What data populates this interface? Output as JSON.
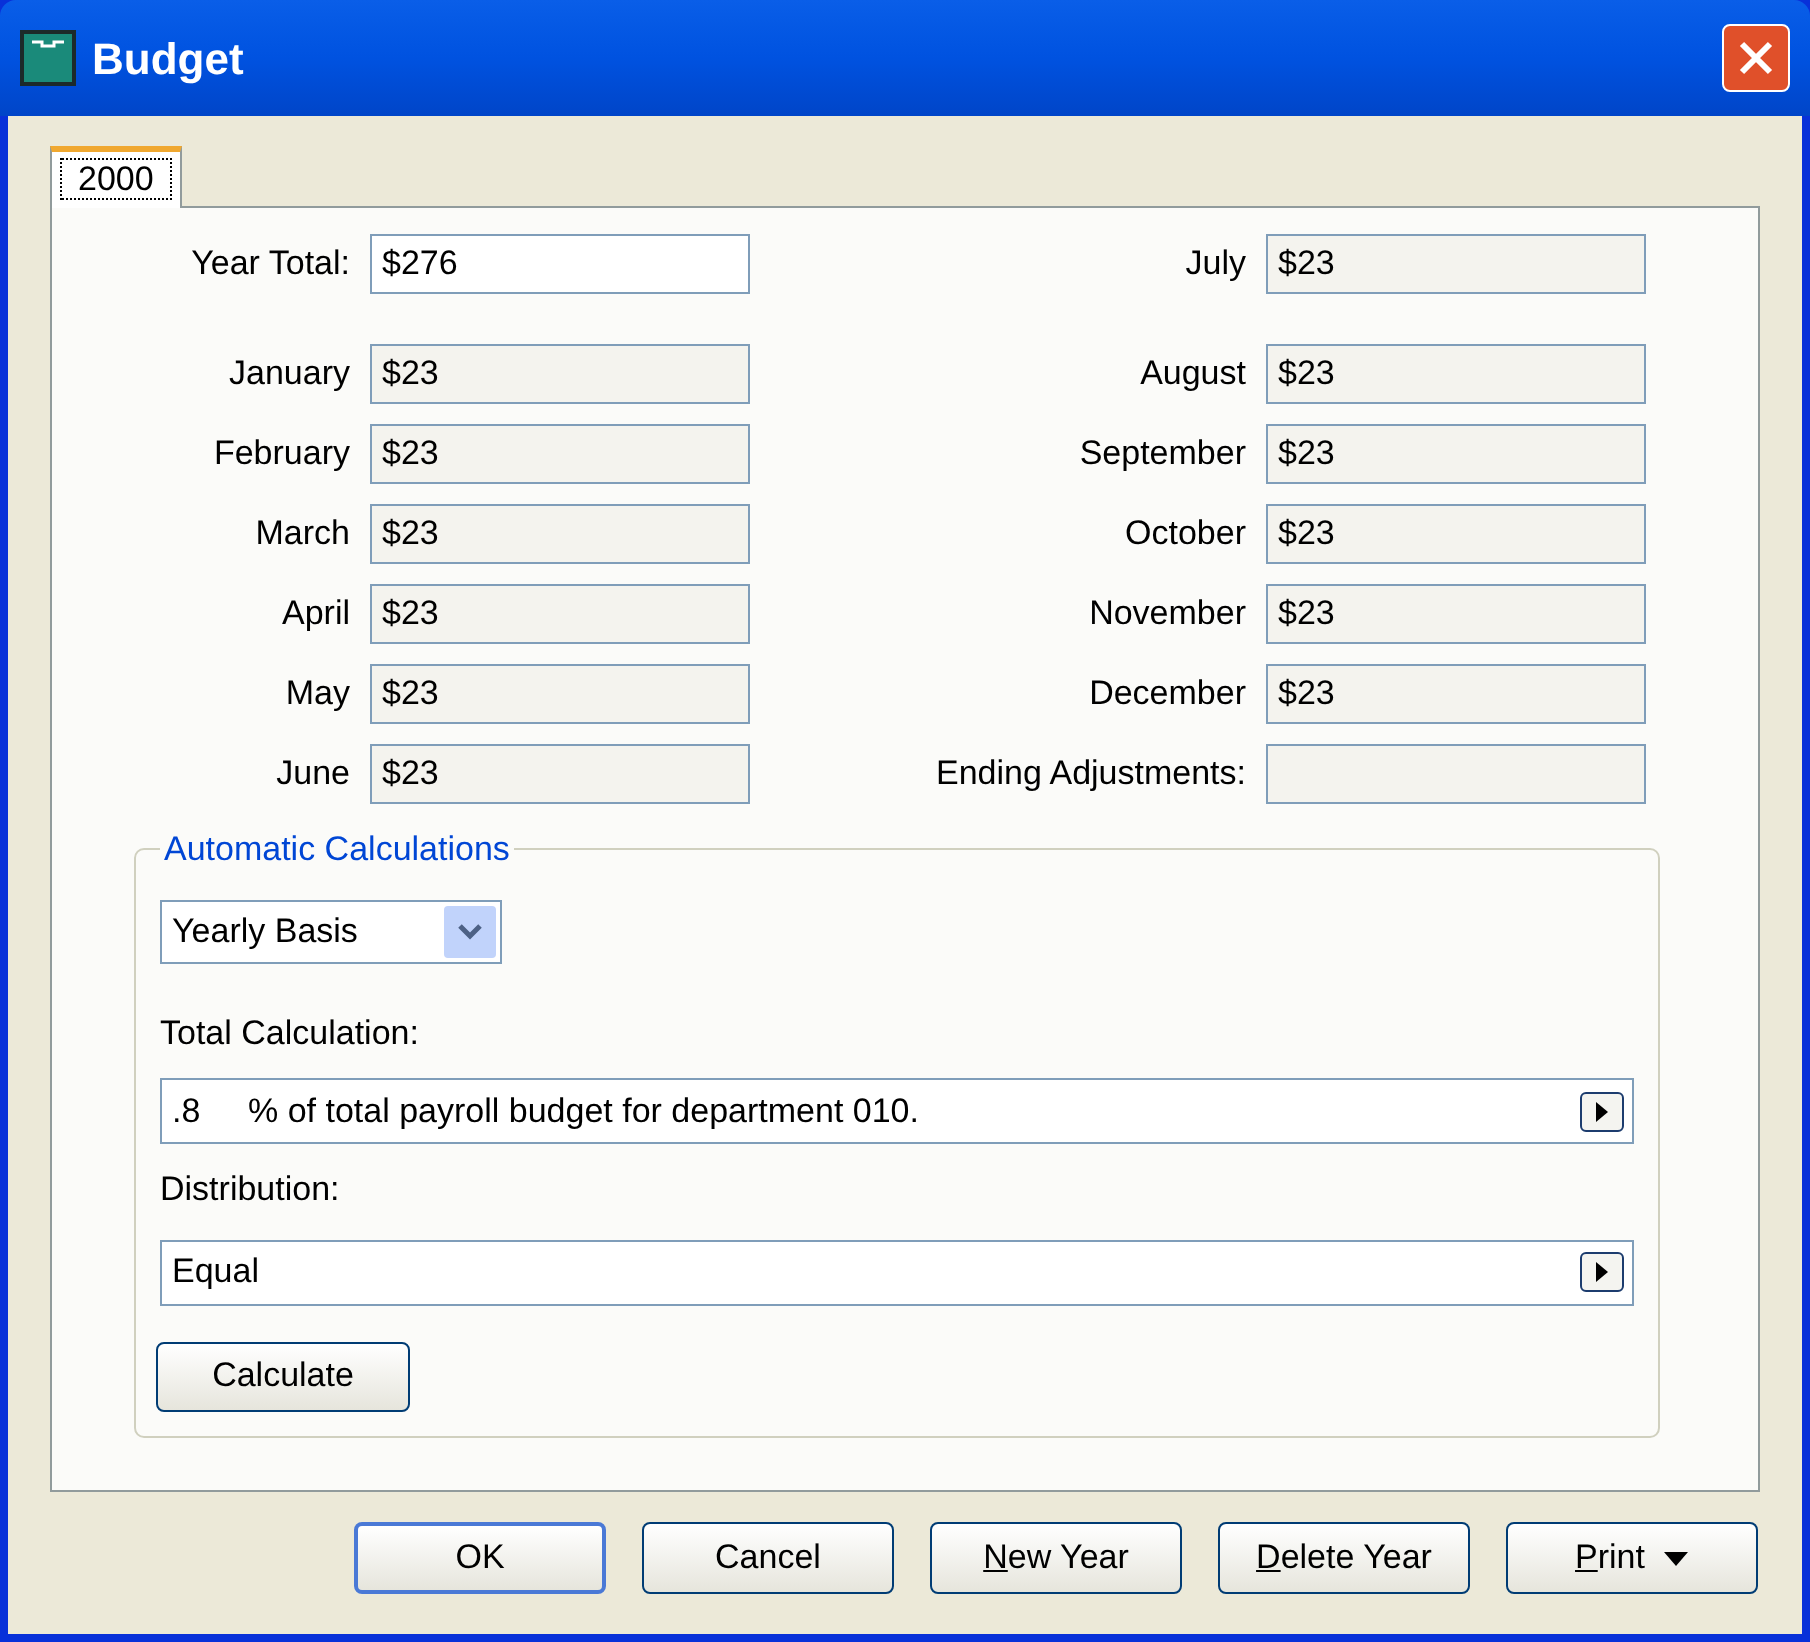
{
  "window": {
    "title": "Budget"
  },
  "tabs": [
    {
      "label": "2000",
      "selected": true
    }
  ],
  "year_total": {
    "label": "Year Total:",
    "value": "$276",
    "readonly": false
  },
  "left_months": [
    {
      "label": "January",
      "value": "$23",
      "readonly": true
    },
    {
      "label": "February",
      "value": "$23",
      "readonly": true
    },
    {
      "label": "March",
      "value": "$23",
      "readonly": true
    },
    {
      "label": "April",
      "value": "$23",
      "readonly": true
    },
    {
      "label": "May",
      "value": "$23",
      "readonly": true
    },
    {
      "label": "June",
      "value": "$23",
      "readonly": true
    }
  ],
  "right_months": [
    {
      "label": "July",
      "value": "$23",
      "readonly": true
    },
    {
      "label": "August",
      "value": "$23",
      "readonly": true
    },
    {
      "label": "September",
      "value": "$23",
      "readonly": true
    },
    {
      "label": "October",
      "value": "$23",
      "readonly": true
    },
    {
      "label": "November",
      "value": "$23",
      "readonly": true
    },
    {
      "label": "December",
      "value": "$23",
      "readonly": true
    },
    {
      "label": "Ending Adjustments:",
      "readonly": true
    }
  ],
  "automatic_calculations": {
    "title": "Automatic Calculations",
    "basis": "Yearly Basis",
    "total_label": "Total Calculation:",
    "total_amount": ".8",
    "total_text": "% of total payroll budget for department 010.",
    "distribution_label": "Distribution:",
    "distribution": "Equal",
    "calculate": "Calculate"
  },
  "buttons": [
    {
      "label": "OK",
      "mnemonic": false,
      "default": true,
      "menu": false
    },
    {
      "label": "Cancel",
      "mnemonic": false,
      "default": false,
      "menu": false
    },
    {
      "label": "New Year",
      "mnemonic": true,
      "default": false,
      "menu": false
    },
    {
      "label": "Delete Year",
      "mnemonic": true,
      "default": false,
      "menu": false
    },
    {
      "label": "Print",
      "mnemonic": true,
      "default": false,
      "menu": true
    }
  ]
}
